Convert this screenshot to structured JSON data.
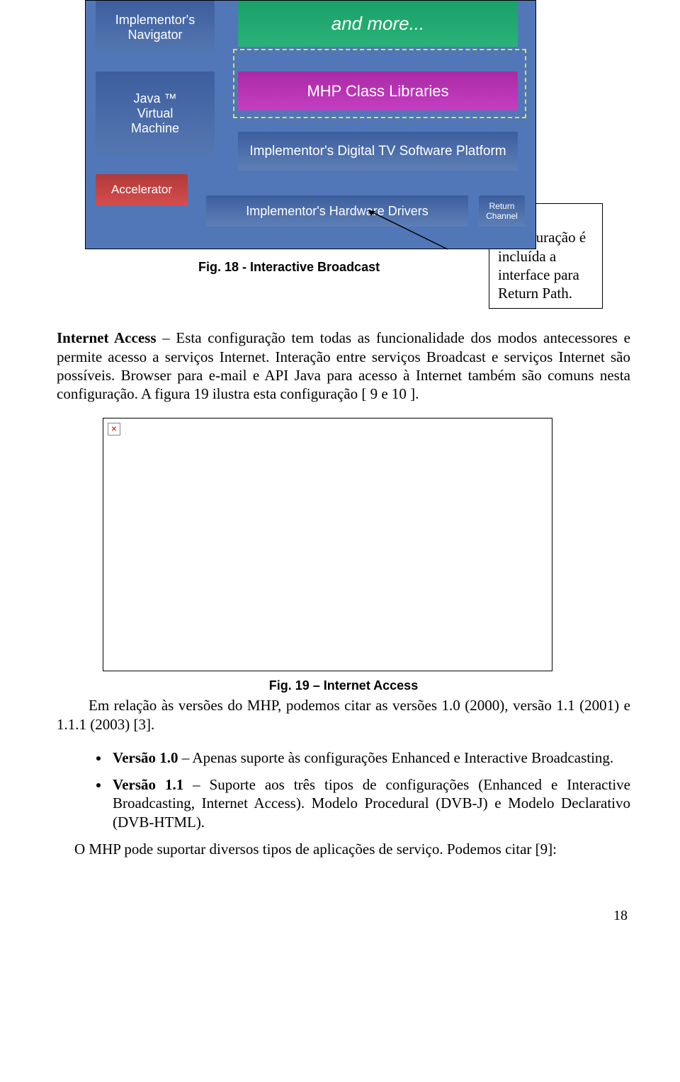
{
  "diagram": {
    "impl_nav": "Implementor's Navigator",
    "and_more": "and more...",
    "jvm": "Java ™\nVirtual\nMachine",
    "class_lib": "MHP Class Libraries",
    "sw_plat": "Implementor's Digital TV Software Platform",
    "accel": "Accelerator",
    "hw": "Implementor's Hardware Drivers",
    "return_ch": "Return Channel"
  },
  "fig18_caption": "Fig. 18 -  Interactive Broadcast",
  "callout": "Nesta configuração é incluída a interface para Return Path.",
  "para1_bold": "Internet Access",
  "para1_rest": " – Esta configuração tem todas as funcionalidade dos modos antecessores e permite acesso a serviços Internet. Interação entre serviços Broadcast e serviços Internet são possíveis. Browser para e-mail e API Java para acesso à Internet também são comuns nesta configuração. A figura 19 ilustra esta configuração [  9 e 10 ].",
  "fig19_caption": "Fig. 19 – Internet Access",
  "para2": "Em relação às versões do MHP, podemos citar as versões 1.0 (2000), versão 1.1 (2001) e 1.1.1 (2003) [3].",
  "bullet1_bold": "Versão 1.0",
  "bullet1_rest": " – Apenas suporte às configurações Enhanced e Interactive Broadcasting.",
  "bullet2_bold": "Versão 1.1",
  "bullet2_rest": " – Suporte aos três tipos de configurações (Enhanced e Interactive Broadcasting, Internet Access). Modelo Procedural (DVB-J) e Modelo Declarativo (DVB-HTML).",
  "closing": "O MHP pode suportar diversos tipos de aplicações de serviço. Podemos citar [9]:",
  "page_number": "18"
}
